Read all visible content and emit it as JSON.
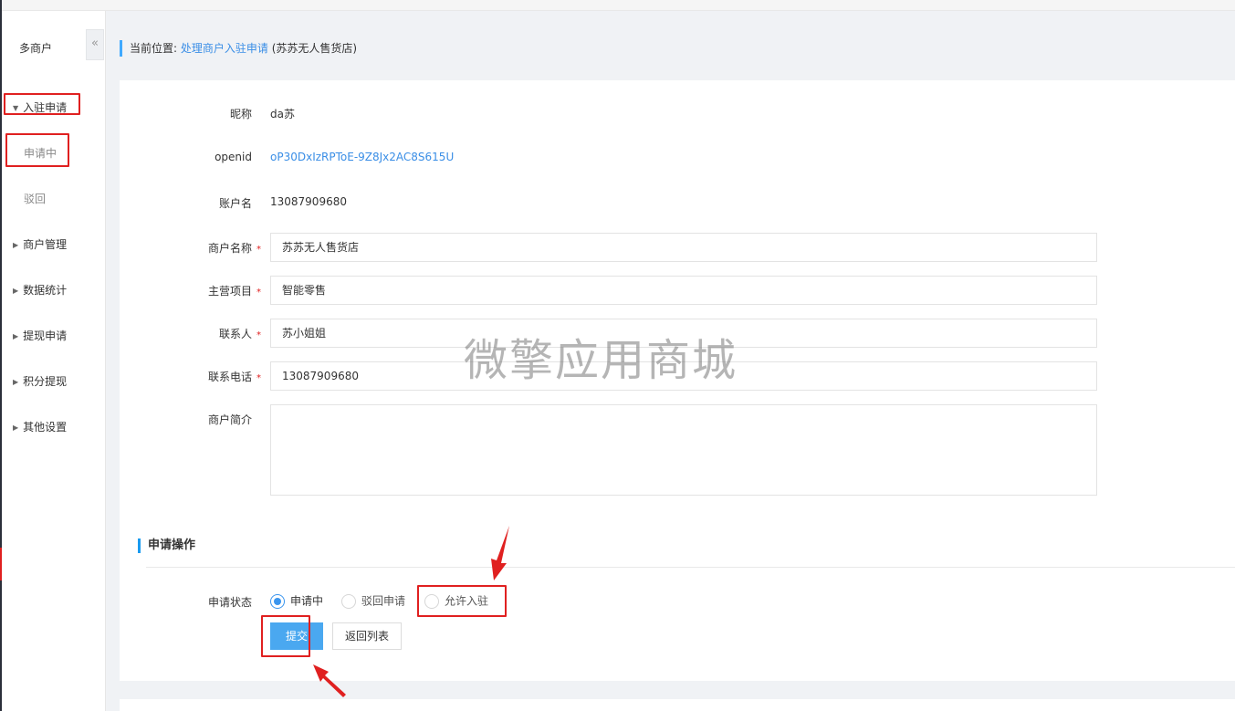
{
  "sidebar": {
    "title": "多商户",
    "collapse_icon": "«",
    "menu": [
      {
        "label": "入驻申请",
        "expanded": true
      },
      {
        "label": "商户管理"
      },
      {
        "label": "数据统计"
      },
      {
        "label": "提现申请"
      },
      {
        "label": "积分提现"
      },
      {
        "label": "其他设置"
      }
    ],
    "submenu": [
      {
        "label": "申请中",
        "active": true
      },
      {
        "label": "驳回"
      }
    ]
  },
  "breadcrumb": {
    "prefix": "当前位置:",
    "link": "处理商户入驻申请",
    "suffix": "(苏苏无人售货店)"
  },
  "form": {
    "nickname": {
      "label": "昵称",
      "value": "da苏"
    },
    "openid": {
      "label": "openid",
      "value": "oP30DxIzRPToE-9Z8Jx2AC8S615U"
    },
    "account": {
      "label": "账户名",
      "value": "13087909680"
    },
    "merchant_name": {
      "label": "商户名称",
      "value": "苏苏无人售货店",
      "required": "*"
    },
    "main_business": {
      "label": "主营项目",
      "value": "智能零售",
      "required": "*"
    },
    "contact": {
      "label": "联系人",
      "value": "苏小姐姐",
      "required": "*"
    },
    "phone": {
      "label": "联系电话",
      "value": "13087909680",
      "required": "*"
    },
    "intro": {
      "label": "商户简介",
      "value": ""
    }
  },
  "watermark": "微擎应用商城",
  "operation": {
    "section_title": "申请操作",
    "status_label": "申请状态",
    "options": [
      {
        "label": "申请中",
        "checked": true
      },
      {
        "label": "驳回申请",
        "checked": false
      },
      {
        "label": "允许入驻",
        "checked": false
      }
    ],
    "submit_label": "提交",
    "back_label": "返回列表"
  },
  "colors": {
    "accent": "#3a95ee",
    "highlight": "#e02020",
    "submit": "#4aa8f0"
  }
}
